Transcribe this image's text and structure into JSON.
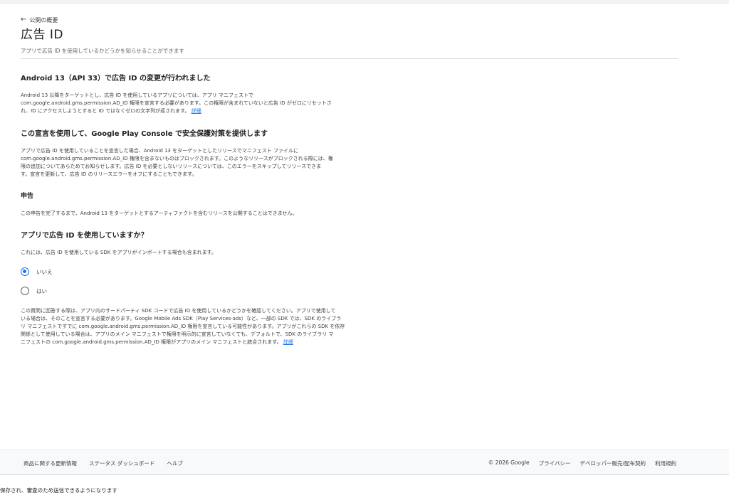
{
  "header": {
    "back_label": "公開の概要",
    "title": "広告 ID",
    "subtitle": "アプリで広告 ID を使用しているかどうかを知らせることができます"
  },
  "section1": {
    "heading": "Android 13（API 33）で広告 ID の変更が行われました",
    "lines": [
      "Android 13 以降をターゲットとし、広告 ID を使用しているアプリについては、アプリ マニフェストで",
      "com.google.android.gms.permission.AD_ID 権限を宣言する必要があります。この権限が含まれていないと広告 ID がゼロにリセットさ",
      "れ、ID にアクセスしようとすると ID ではなくゼロの文字列が返されます。"
    ],
    "link": "詳細"
  },
  "section2": {
    "heading": "この宣言を使用して、Google Play Console で安全保護対策を提供します",
    "lines": [
      "アプリで広告 ID を使用していることを宣言した場合、Android 13 をターゲットとしたリリースでマニフェスト ファイルに",
      "com.google.android.gms.permission.AD_ID 権限を含まないものはブロックされます。このようなリリースがブロックされる際には、権",
      "限の追加についてあらためてお知らせします。広告 ID を必要としないリリースについては、このエラーをスキップしてリリースできま",
      "す。宣言を更新して、広告 ID のリリースエラーをオフにすることもできます。"
    ]
  },
  "section3": {
    "heading": "申告",
    "text": "この申告を完了するまで、Android 13 をターゲットとするアーティファクトを含むリリースを公開することはできません。"
  },
  "question": {
    "heading": "アプリで広告 ID を使用していますか？",
    "note": "これには、広告 ID を使用している SDK をアプリがインポートする場合も含まれます。",
    "options": [
      {
        "label": "いいえ",
        "selected": true
      },
      {
        "label": "はい",
        "selected": false
      }
    ]
  },
  "info": {
    "lines": [
      "この質問に回答する際は、アプリ内のサードパーティ SDK コードで広告 ID を使用しているかどうかを確認してください。アプリで使用して",
      "いる場合は、そのことを宣言する必要があります。Google Mobile Ads SDK（Play Services-ads）など、一部の SDK では、SDK のライブラ",
      "リ マニフェストですでに com.google.android.gms.permission.AD_ID 権限を宣言している可能性があります。アプリがこれらの SDK を依存",
      "関係として使用している場合は、アプリのメイン マニフェストで権限を明示的に宣言していなくても、デフォルトで、SDK のライブラリ マ",
      "ニフェストの com.google.android.gms.permission.AD_ID 権限がアプリのメイン マニフェストと統合されます。"
    ],
    "link": "詳細"
  },
  "footer": {
    "left": [
      "商品に関する更新情報",
      "ステータス ダッシュボード",
      "ヘルプ"
    ],
    "right": [
      "© 2026 Google",
      "プライバシー",
      "デベロッパー販売/配布契約",
      "利用規約"
    ]
  },
  "bottom_message": "保存され、審査のため送信できるようになります"
}
